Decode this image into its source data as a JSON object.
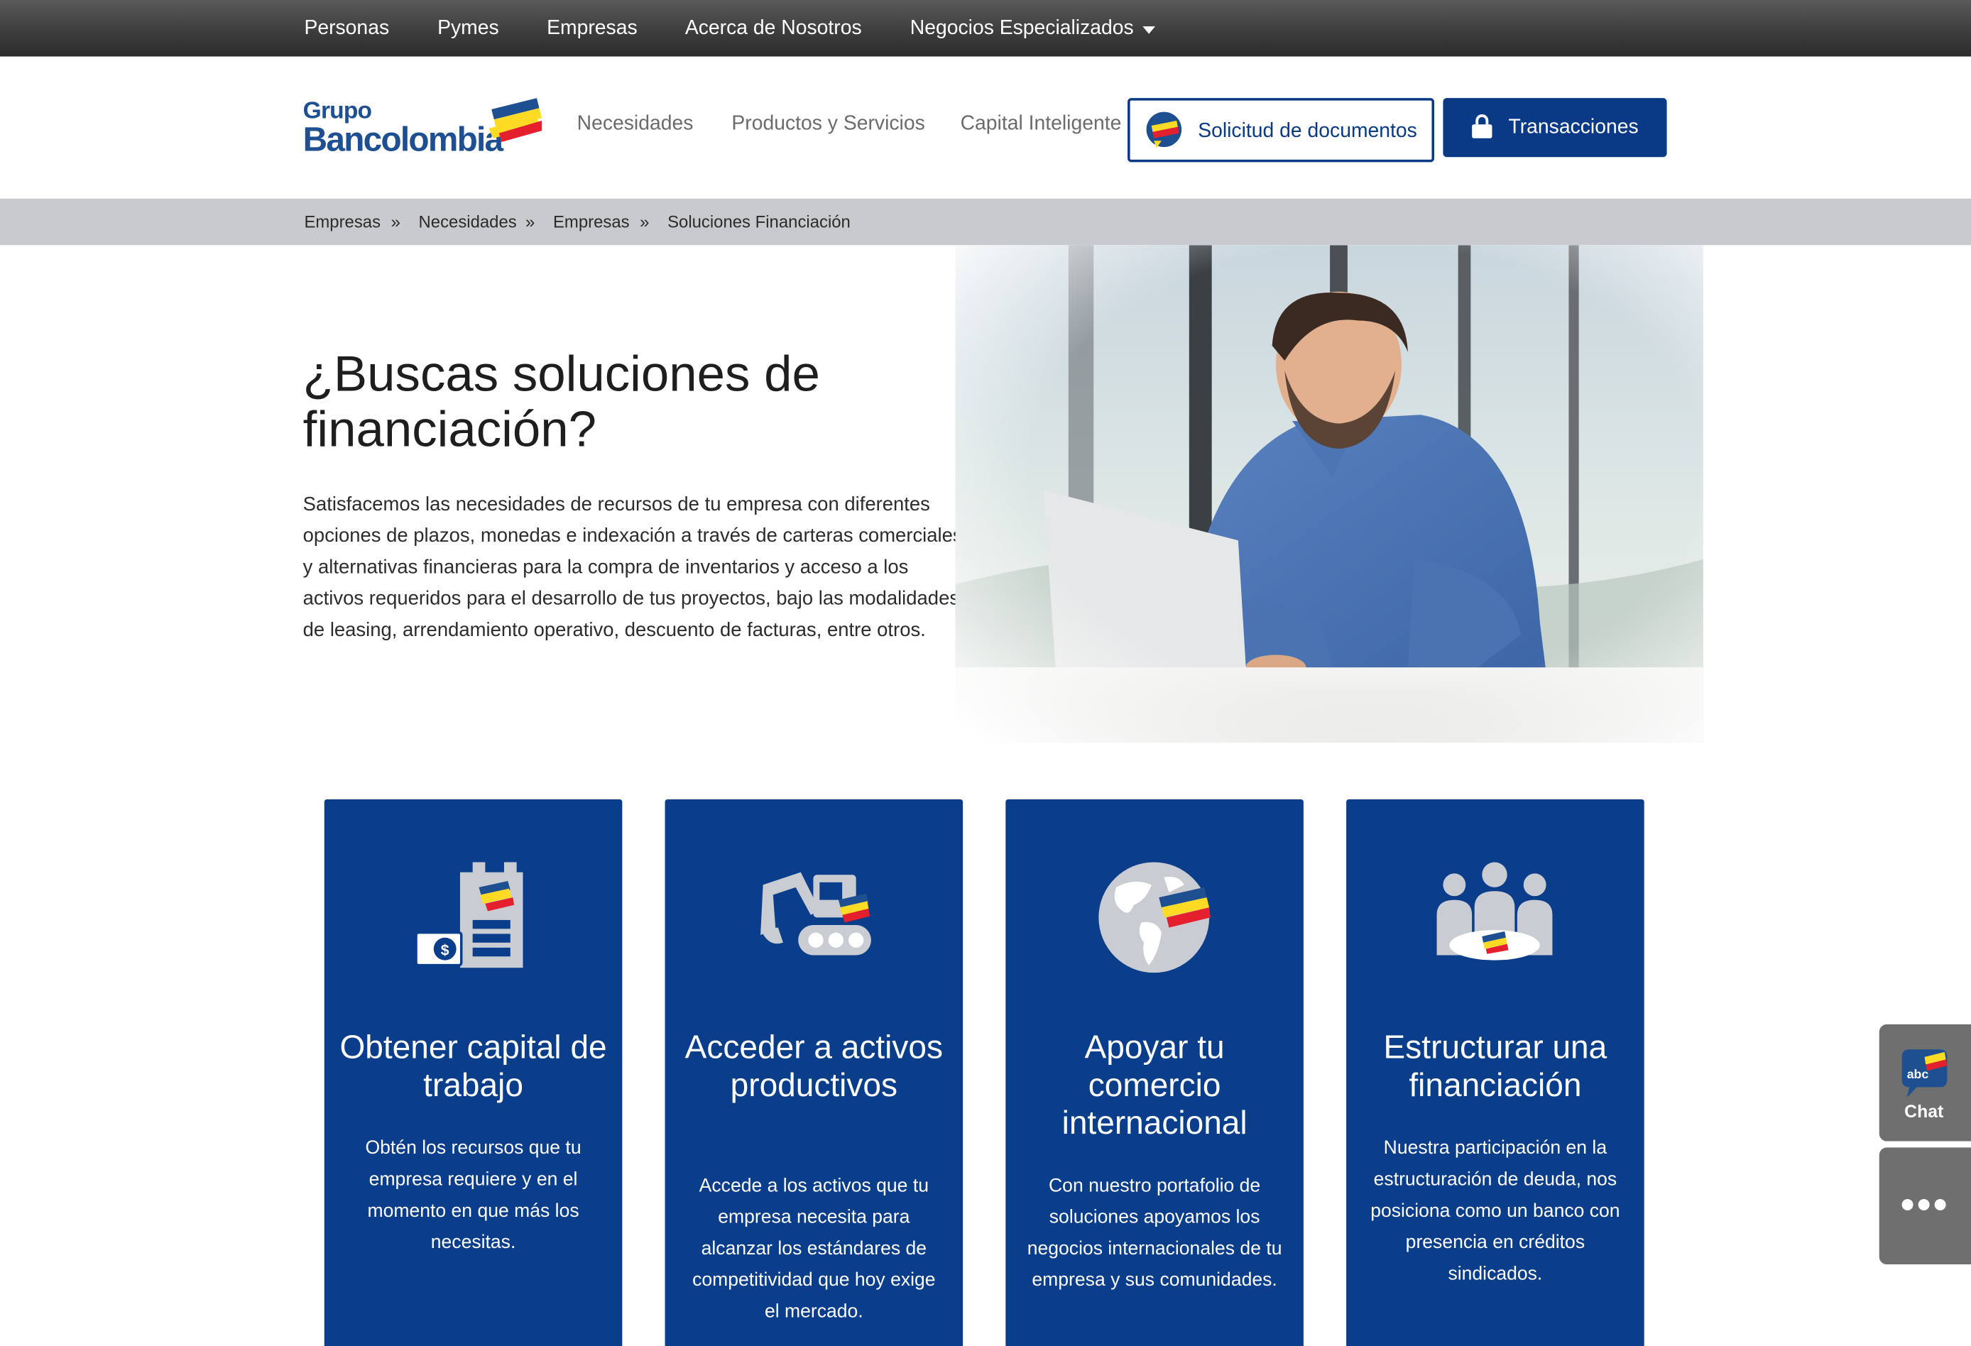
{
  "topbar": {
    "items": [
      "Personas",
      "Pymes",
      "Empresas",
      "Acerca de Nosotros",
      "Negocios Especializados"
    ]
  },
  "header": {
    "logo_line1": "Grupo",
    "logo_line2": "Bancolombia",
    "nav": [
      "Necesidades",
      "Productos y Servicios",
      "Capital Inteligente"
    ],
    "docs_button": "Solicitud de documentos",
    "transactions_button": "Transacciones"
  },
  "breadcrumb": [
    "Empresas",
    "»",
    "Necesidades",
    "»",
    "Empresas",
    "»",
    "Soluciones Financiación"
  ],
  "hero": {
    "title": "¿Buscas soluciones de financiación?",
    "text": "Satisfacemos las necesidades de recursos de tu empresa con diferentes opciones de plazos, monedas e indexación a través de carteras comerciales y alternativas financieras para la compra de inventarios y acceso a los activos requeridos para el desarrollo de tus proyectos, bajo las modalidades de leasing, arrendamiento operativo, descuento de facturas, entre otros."
  },
  "cards": [
    {
      "icon": "building-money-icon",
      "title": "Obtener capital de trabajo",
      "text": "Obtén los recursos que tu empresa requiere y en el momento en que más los necesitas."
    },
    {
      "icon": "excavator-icon",
      "title": "Acceder a activos productivos",
      "text": "Accede a los activos que tu empresa necesita para alcanzar los estándares de competitividad que hoy exige el mercado."
    },
    {
      "icon": "globe-icon",
      "title": "Apoyar tu comercio internacional",
      "text": "Con nuestro portafolio de soluciones apoyamos los negocios internacionales de tu empresa y sus comunidades."
    },
    {
      "icon": "meeting-icon",
      "title": "Estructurar una financiación",
      "text": "Nuestra participación en la estructuración de deuda, nos posiciona como un banco con presencia en créditos sindicados."
    }
  ],
  "widgets": {
    "chat_badge": "abc",
    "chat_label": "Chat"
  },
  "colors": {
    "brand_blue": "#0a3d8a",
    "flag_yellow": "#fdda24",
    "flag_blue": "#1d4f91",
    "flag_red": "#e4202e"
  }
}
